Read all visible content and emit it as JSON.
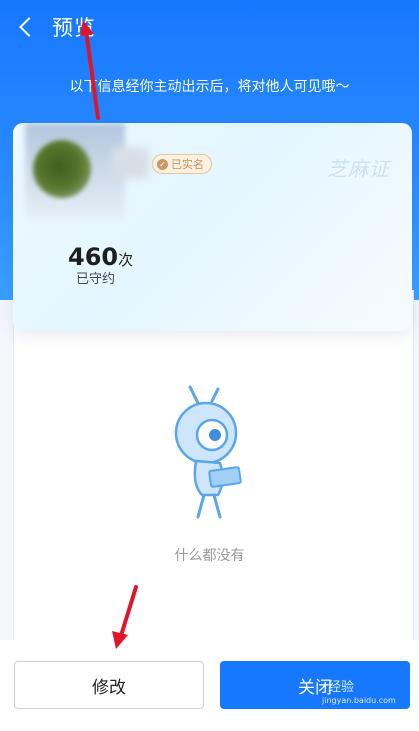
{
  "header": {
    "title": "预览"
  },
  "notice": "以下信息经你主动出示后，将对他人可见哦～",
  "card": {
    "verified_badge": "已实名",
    "brand": "芝麻证",
    "stat_value": "460",
    "stat_unit": "次",
    "stat_label": "已守约"
  },
  "empty": {
    "text": "什么都没有"
  },
  "buttons": {
    "edit_label": "修改",
    "close_label": "关闭"
  },
  "watermark": {
    "text": "经验",
    "site": "jingyan.baidu.com"
  },
  "colors": {
    "primary": "#1677ff",
    "annotation_arrow": "#e0152a",
    "badge": "#c7905a"
  }
}
